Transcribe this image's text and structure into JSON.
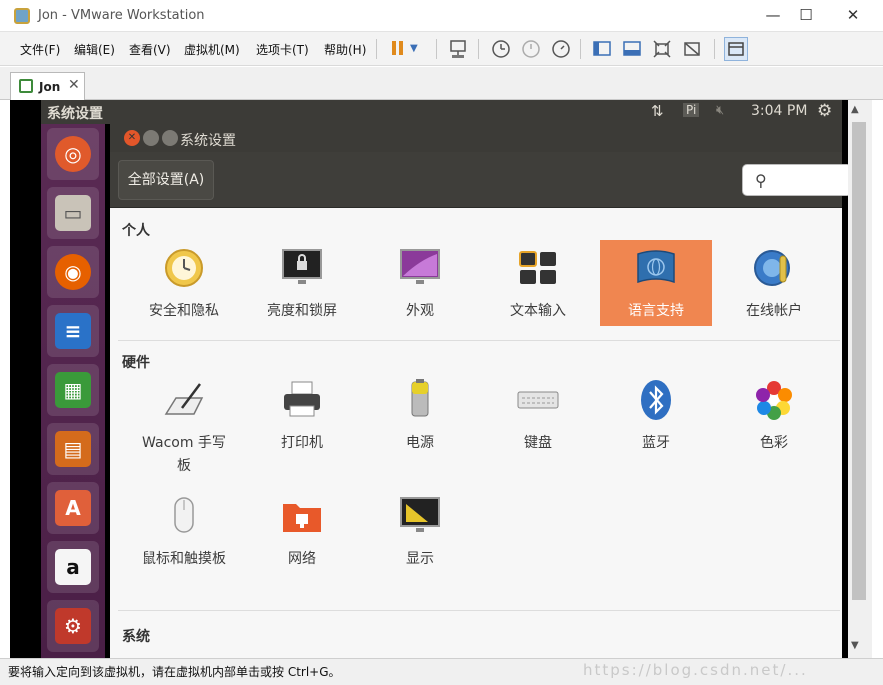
{
  "window": {
    "title": "Jon - VMware Workstation",
    "minimize": "—",
    "maximize": "☐",
    "close": "✕"
  },
  "menu": [
    "文件(F)",
    "编辑(E)",
    "查看(V)",
    "虚拟机(M)",
    "选项卡(T)",
    "帮助(H)"
  ],
  "tab": {
    "label": "Jon",
    "close": "✕"
  },
  "ubuntu": {
    "top_title": "系统设置",
    "time": "3:04 PM",
    "indicator_pi": "Pi"
  },
  "settings": {
    "title": "系统设置",
    "all_settings_button": "全部设置(A)",
    "sections": {
      "personal": "个人",
      "hardware": "硬件",
      "system": "系统"
    },
    "personal_items": [
      "安全和隐私",
      "亮度和锁屏",
      "外观",
      "文本输入",
      "语言支持",
      "在线帐户"
    ],
    "hardware_items": [
      "Wacom 手写板",
      "打印机",
      "电源",
      "键盘",
      "蓝牙",
      "色彩"
    ],
    "hardware_items_2": [
      "鼠标和触摸板",
      "网络",
      "显示"
    ],
    "selected": "语言支持"
  },
  "status": {
    "message": "要将输入定向到该虚拟机，请在虚拟机内部单击或按 Ctrl+G。",
    "watermark": "https://blog.csdn.net/..."
  },
  "colors": {
    "selected": "#f08650",
    "launcher": "#5a2a54",
    "ubuntu_panel": "#3c3b37"
  }
}
